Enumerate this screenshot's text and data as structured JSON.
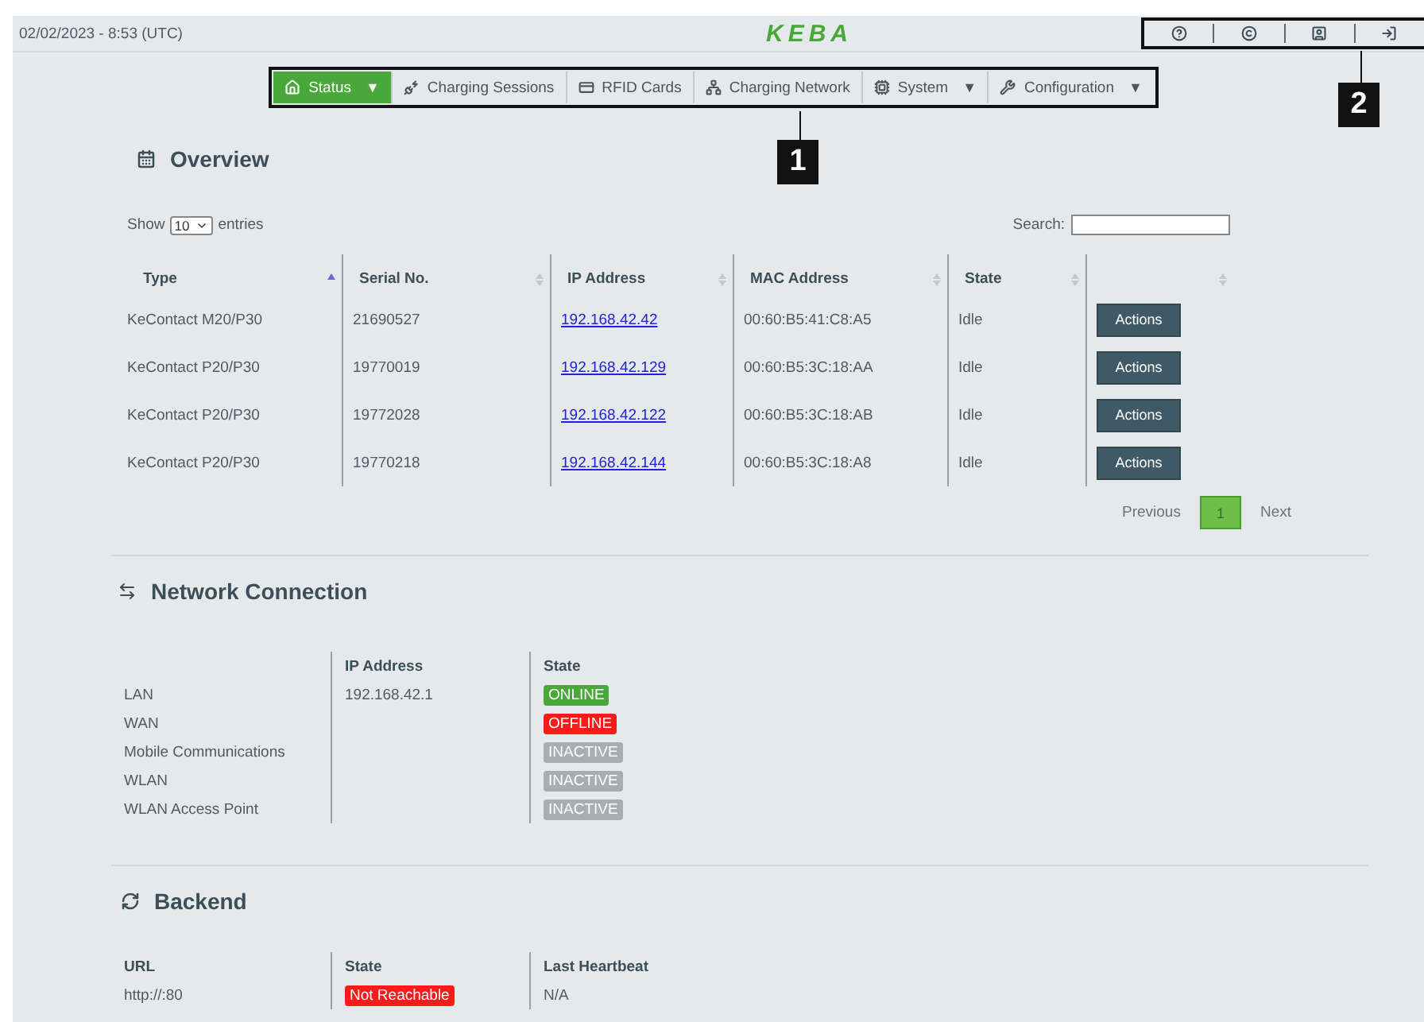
{
  "header": {
    "datetime": "02/02/2023 - 8:53 (UTC)",
    "logo": "KEBA",
    "icons": [
      {
        "kind": "help"
      },
      {
        "kind": "copyright"
      },
      {
        "kind": "user"
      },
      {
        "kind": "logout"
      }
    ]
  },
  "nav": [
    {
      "label": "Status",
      "kind": "home",
      "caret": "▼",
      "selected": true
    },
    {
      "label": "Charging Sessions",
      "kind": "sessions",
      "selected": false
    },
    {
      "label": "RFID Cards",
      "kind": "card",
      "selected": false
    },
    {
      "label": "Charging Network",
      "kind": "network",
      "selected": false
    },
    {
      "label": "System",
      "kind": "system",
      "caret": "▼",
      "selected": false
    },
    {
      "label": "Configuration",
      "kind": "wrench",
      "caret": "▼",
      "selected": false
    }
  ],
  "callouts": [
    "1",
    "2"
  ],
  "overview": {
    "title": "Overview",
    "show_label": "Show",
    "entries_value": "10",
    "entries_label": "entries",
    "search_label": "Search:",
    "columns": [
      {
        "label": "Type",
        "sorted": true
      },
      {
        "label": "Serial No.",
        "sorted": false
      },
      {
        "label": "IP Address",
        "sorted": false
      },
      {
        "label": "MAC Address",
        "sorted": false
      },
      {
        "label": "State",
        "sorted": false
      },
      {
        "sorted": false
      }
    ],
    "rows": [
      {
        "type": "KeContact M20/P30",
        "serial": "21690527",
        "ip": "192.168.42.42",
        "mac": "00:60:B5:41:C8:A5",
        "state": "Idle",
        "action": "Actions"
      },
      {
        "type": "KeContact P20/P30",
        "serial": "19770019",
        "ip": "192.168.42.129",
        "mac": "00:60:B5:3C:18:AA",
        "state": "Idle",
        "action": "Actions"
      },
      {
        "type": "KeContact P20/P30",
        "serial": "19772028",
        "ip": "192.168.42.122",
        "mac": "00:60:B5:3C:18:AB",
        "state": "Idle",
        "action": "Actions"
      },
      {
        "type": "KeContact P20/P30",
        "serial": "19770218",
        "ip": "192.168.42.144",
        "mac": "00:60:B5:3C:18:A8",
        "state": "Idle",
        "action": "Actions"
      }
    ],
    "pagination": {
      "previous": "Previous",
      "page": "1",
      "next": "Next"
    }
  },
  "network": {
    "title": "Network Connection",
    "columns": [
      "IP Address",
      "State"
    ],
    "rows": [
      {
        "name": "LAN",
        "ip": "192.168.42.1",
        "state": "ONLINE",
        "kind": "online"
      },
      {
        "name": "WAN",
        "state": "OFFLINE",
        "kind": "offline"
      },
      {
        "name": "Mobile Communications",
        "state": "INACTIVE",
        "kind": "inactive"
      },
      {
        "name": "WLAN",
        "state": "INACTIVE",
        "kind": "inactive"
      },
      {
        "name": "WLAN Access Point",
        "state": "INACTIVE",
        "kind": "inactive"
      }
    ]
  },
  "backend": {
    "title": "Backend",
    "url_label": "URL",
    "url": "http://:80",
    "state_label": "State",
    "state": {
      "text": "Not Reachable",
      "kind": "offline"
    },
    "heartbeat_label": "Last Heartbeat",
    "heartbeat": "N/A"
  }
}
